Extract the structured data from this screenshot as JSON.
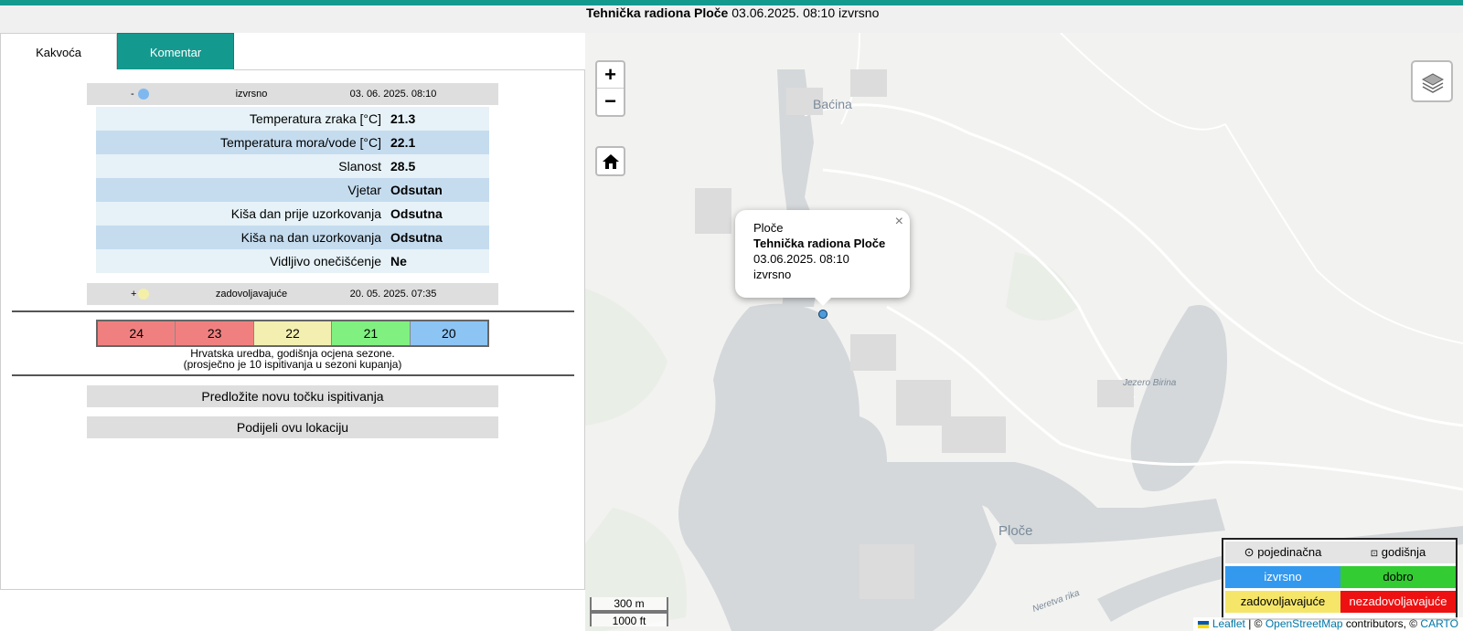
{
  "header": {
    "station": "Tehnička radiona Ploče",
    "datetime_quality": "03.06.2025. 08:10 izvrsno"
  },
  "tabs": [
    {
      "label": "Kakvoća"
    },
    {
      "label": "Komentar"
    }
  ],
  "samples": [
    {
      "toggle": "-",
      "dot_color": "#7fb8ee",
      "quality": "izvrsno",
      "date": "03. 06. 2025. 08:10"
    },
    {
      "toggle": "+",
      "dot_color": "#f3efa8",
      "quality": "zadovoljavajuće",
      "date": "20. 05. 2025. 07:35"
    }
  ],
  "params": [
    {
      "label": "Temperatura zraka [°C]",
      "value": "21.3"
    },
    {
      "label": "Temperatura mora/vode [°C]",
      "value": "22.1"
    },
    {
      "label": "Slanost",
      "value": "28.5"
    },
    {
      "label": "Vjetar",
      "value": "Odsutan"
    },
    {
      "label": "Kiša dan prije uzorkovanja",
      "value": "Odsutna"
    },
    {
      "label": "Kiša na dan uzorkovanja",
      "value": "Odsutna"
    },
    {
      "label": "Vidljivo onečišćenje",
      "value": "Ne"
    }
  ],
  "season": {
    "cells": [
      {
        "year": "24",
        "color": "#f08080"
      },
      {
        "year": "23",
        "color": "#f08080"
      },
      {
        "year": "22",
        "color": "#f3efb0"
      },
      {
        "year": "21",
        "color": "#80f080"
      },
      {
        "year": "20",
        "color": "#8cc4f4"
      }
    ],
    "note_line1": "Hrvatska uredba, godišnja ocjena sezone.",
    "note_line2": "(prosječno je 10 ispitivanja u sezoni kupanja)"
  },
  "actions": {
    "suggest": "Predložite novu točku ispitivanja",
    "share": "Podijeli ovu lokaciju"
  },
  "map": {
    "zoom_in": "+",
    "zoom_out": "−",
    "labels": {
      "bacina": "Baćina",
      "ploce": "Ploče",
      "lake": "Jezero Birina",
      "river": "Neretva rika"
    },
    "popup": {
      "place": "Ploče",
      "station": "Tehnička radiona Ploče",
      "datetime": "03.06.2025. 08:10",
      "quality": "izvrsno",
      "close": "×"
    },
    "scale": {
      "metric": "300 m",
      "imperial": "1000 ft"
    },
    "attribution": {
      "leaflet": "Leaflet",
      "sep1": " | © ",
      "osm": "OpenStreetMap",
      "sep2": " contributors, © ",
      "carto": "CARTO"
    }
  },
  "legend": {
    "single": "pojedinačna",
    "annual": "godišnja",
    "items": [
      {
        "label": "izvrsno",
        "color": "#3399ee",
        "text_color": "#ffffff"
      },
      {
        "label": "dobro",
        "color": "#33cc33",
        "text_color": "#000000"
      },
      {
        "label": "zadovoljavajuće",
        "color": "#f5e66a",
        "text_color": "#000000"
      },
      {
        "label": "nezadovoljavajuće",
        "color": "#ee1111",
        "text_color": "#ffffff"
      }
    ]
  },
  "colors": {
    "accent": "#14998f",
    "water": "#d4d8db"
  }
}
